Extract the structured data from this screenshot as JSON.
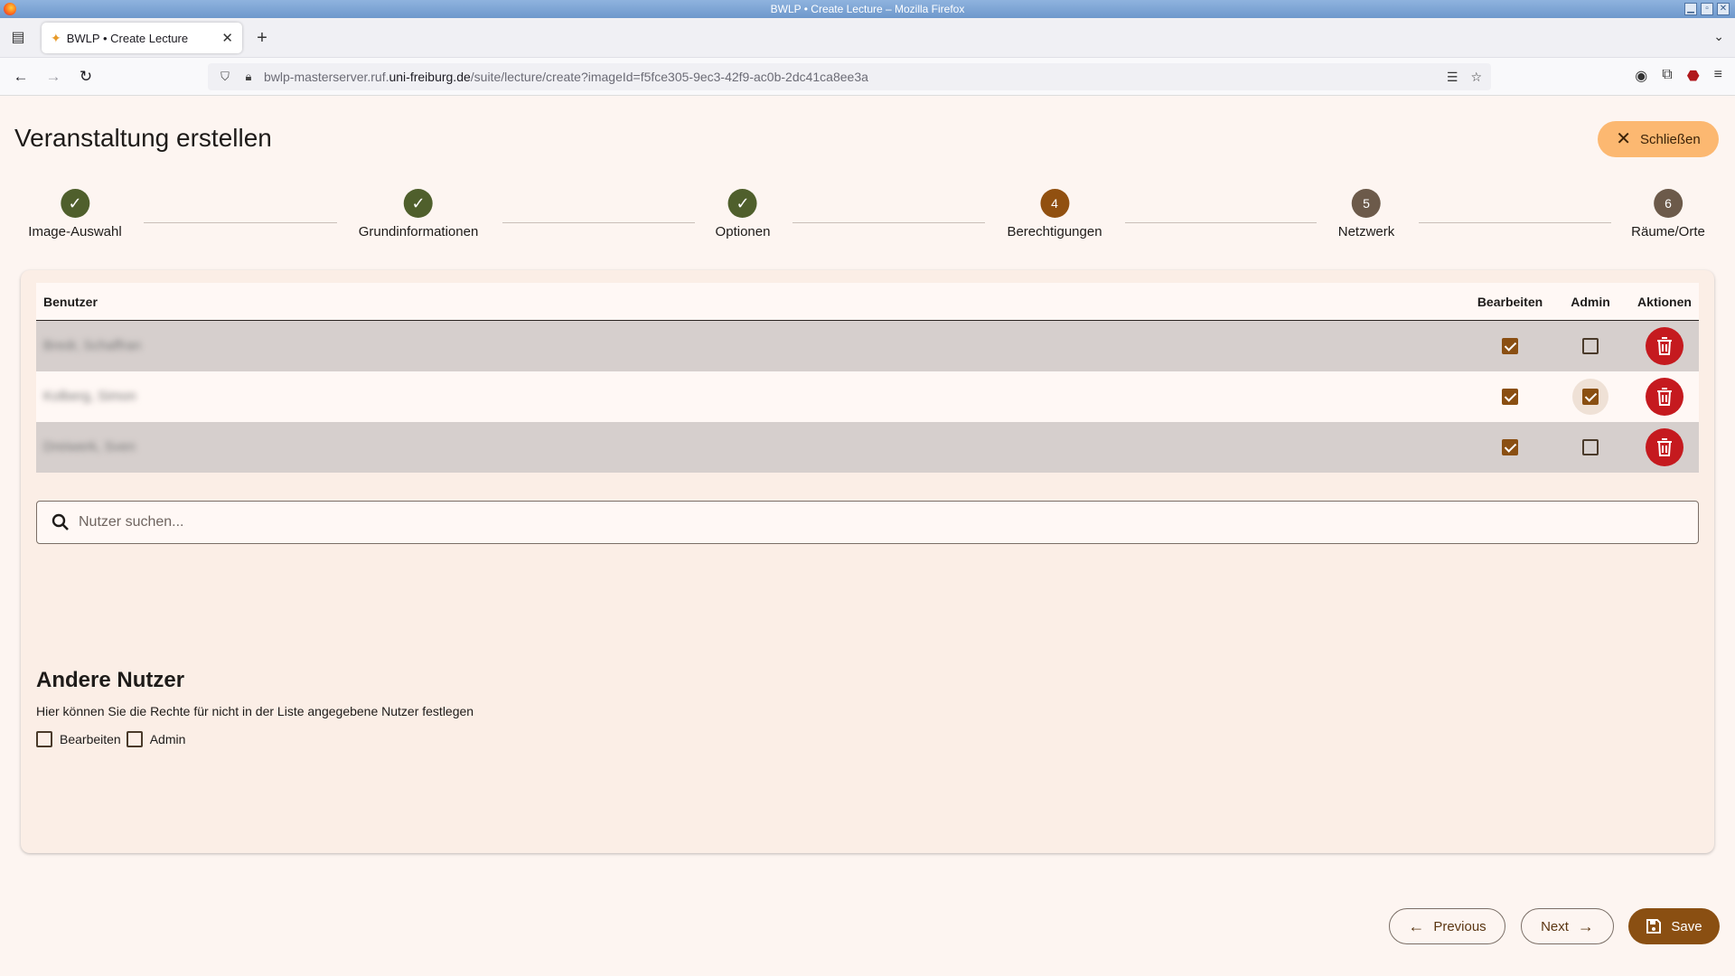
{
  "window": {
    "title": "BWLP • Create Lecture – Mozilla Firefox"
  },
  "tab": {
    "title": "BWLP • Create Lecture"
  },
  "url": {
    "prefix": "bwlp-masterserver.ruf.",
    "host": "uni-freiburg.de",
    "path": "/suite/lecture/create?imageId=f5fce305-9ec3-42f9-ac0b-2dc41ca8ee3a"
  },
  "page": {
    "title": "Veranstaltung erstellen",
    "close_label": "Schließen"
  },
  "stepper": [
    {
      "label": "Image-Auswahl",
      "state": "done",
      "marker": "✓"
    },
    {
      "label": "Grundinformationen",
      "state": "done",
      "marker": "✓"
    },
    {
      "label": "Optionen",
      "state": "done",
      "marker": "✓"
    },
    {
      "label": "Berechtigungen",
      "state": "active",
      "marker": "4"
    },
    {
      "label": "Netzwerk",
      "state": "todo",
      "marker": "5"
    },
    {
      "label": "Räume/Orte",
      "state": "todo",
      "marker": "6"
    }
  ],
  "table": {
    "headers": {
      "user": "Benutzer",
      "edit": "Bearbeiten",
      "admin": "Admin",
      "actions": "Aktionen"
    },
    "rows": [
      {
        "name": "Bredr, Schaffran",
        "edit": true,
        "admin": false
      },
      {
        "name": "Kolberg, Simon",
        "edit": true,
        "admin": true
      },
      {
        "name": "Dreiwerk, Sven",
        "edit": true,
        "admin": false
      }
    ]
  },
  "search": {
    "placeholder": "Nutzer suchen...",
    "value": ""
  },
  "other_users": {
    "title": "Andere Nutzer",
    "description": "Hier können Sie die Rechte für nicht in der Liste angegebene Nutzer festlegen",
    "edit_label": "Bearbeiten",
    "admin_label": "Admin",
    "edit_checked": false,
    "admin_checked": false
  },
  "footer": {
    "previous_label": "Previous",
    "next_label": "Next",
    "save_label": "Save"
  },
  "colors": {
    "primary": "#8a4f12",
    "done_step": "#4f5f2c",
    "delete": "#c51a1f",
    "close_button": "#fcb871",
    "background": "#fdf5f1"
  }
}
